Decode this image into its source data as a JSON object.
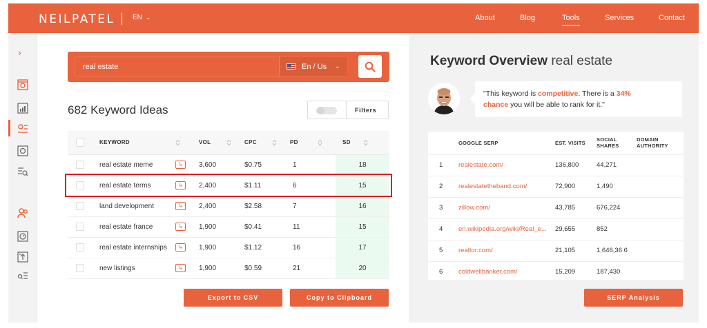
{
  "header": {
    "logo": "NEILPATEL",
    "separator": "|",
    "language": "EN",
    "nav": [
      "About",
      "Blog",
      "Tools",
      "Services",
      "Contact"
    ],
    "active_nav": "Tools"
  },
  "colors": {
    "brand": "#e8633d",
    "highlight": "#e11b22",
    "sd_bg": "#eafaf0"
  },
  "search": {
    "query": "real estate",
    "locale": "En / Us"
  },
  "ideas": {
    "count_label": "682 Keyword Ideas",
    "filters_label": "Filters"
  },
  "keywords_table": {
    "headers": [
      "KEYWORD",
      "VOL",
      "CPC",
      "PD",
      "SD"
    ],
    "rows": [
      {
        "keyword": "real estate meme",
        "vol": "3,600",
        "cpc": "$0.75",
        "pd": "1",
        "sd": "18"
      },
      {
        "keyword": "real estate terms",
        "vol": "2,400",
        "cpc": "$1.11",
        "pd": "6",
        "sd": "15"
      },
      {
        "keyword": "land development",
        "vol": "2,400",
        "cpc": "$2.58",
        "pd": "7",
        "sd": "16"
      },
      {
        "keyword": "real estate france",
        "vol": "1,900",
        "cpc": "$0.41",
        "pd": "11",
        "sd": "15"
      },
      {
        "keyword": "real estate internships",
        "vol": "1,900",
        "cpc": "$1.12",
        "pd": "16",
        "sd": "17"
      },
      {
        "keyword": "new listings",
        "vol": "1,900",
        "cpc": "$0.59",
        "pd": "21",
        "sd": "20"
      }
    ],
    "highlighted_row": 1
  },
  "actions": {
    "export_csv": "Export to CSV",
    "copy_clipboard": "Copy to Clipboard",
    "serp_analysis": "SERP Analysis"
  },
  "overview": {
    "title_bold": "Keyword Overview",
    "title_keyword": "real estate",
    "bubble_prefix": "\"This keyword is ",
    "bubble_competitive": "competitive",
    "bubble_mid": ". There is a ",
    "bubble_pct": "34%",
    "bubble_chance": "chance",
    "bubble_suffix": " you will be able to rank for it.\""
  },
  "serp_table": {
    "headers": [
      "GOOGLE SERP",
      "EST. VISITS",
      "SOCIAL SHARES",
      "DOMAIN AUTHORITY"
    ],
    "rows": [
      {
        "rank": "1",
        "url": "realestate.com/",
        "visits": "136,800",
        "shares": "44,271",
        "da": ""
      },
      {
        "rank": "2",
        "url": "realestatetheband.com/",
        "visits": "72,900",
        "shares": "1,490",
        "da": ""
      },
      {
        "rank": "3",
        "url": "zillow.com/",
        "visits": "43,785",
        "shares": "676,224",
        "da": ""
      },
      {
        "rank": "4",
        "url": "en.wikipedia.org/wiki/Real_e...",
        "visits": "29,655",
        "shares": "852",
        "da": ""
      },
      {
        "rank": "5",
        "url": "realtor.com/",
        "visits": "21,105",
        "shares": "1,646,36 6",
        "da": ""
      },
      {
        "rank": "6",
        "url": "coldwellbanker.com/",
        "visits": "15,209",
        "shares": "187,430",
        "da": ""
      }
    ]
  },
  "icons": {
    "sidebar": [
      "chevron-right-icon",
      "keyword-report-icon",
      "site-audit-icon",
      "keyword-ideas-icon",
      "backlinks-icon",
      "content-ideas-icon",
      "user-group-icon",
      "rank-tracker-icon",
      "upload-icon",
      "search-list-icon"
    ]
  }
}
